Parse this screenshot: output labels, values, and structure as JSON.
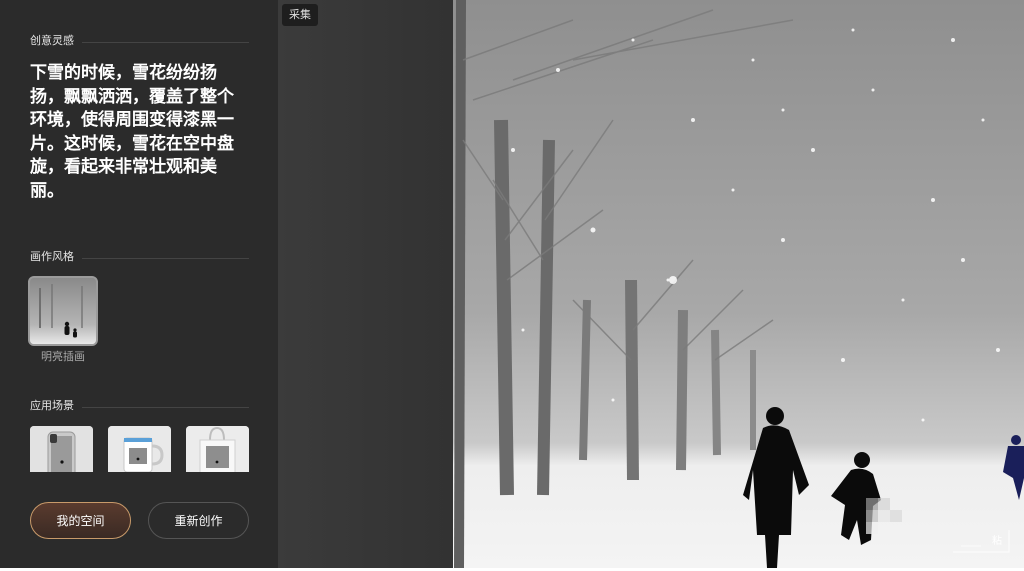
{
  "sections": {
    "inspiration": "创意灵感",
    "style": "画作风格",
    "scene": "应用场景"
  },
  "prompt_lines": [
    "下雪的时候，雪花纷纷扬",
    "扬，飘飘洒洒，覆盖了整个",
    "环境，使得周围变得漆黑一",
    "片。这时候，雪花在空中盘",
    "旋，看起来非常壮观和美",
    "丽。"
  ],
  "style_item": {
    "label": "明亮插画"
  },
  "scene_items": [
    {
      "icon": "phone-case-mockup-icon"
    },
    {
      "icon": "mug-mockup-icon"
    },
    {
      "icon": "tote-bag-mockup-icon"
    }
  ],
  "buttons": {
    "my_space": "我的空间",
    "recreate": "重新创作"
  },
  "collect_label": "采集",
  "watermark_text": "粘",
  "colors": {
    "sidebar_bg": "#2b2b2b",
    "accent_border": "#c89a6a",
    "text_primary": "#ffffff"
  }
}
